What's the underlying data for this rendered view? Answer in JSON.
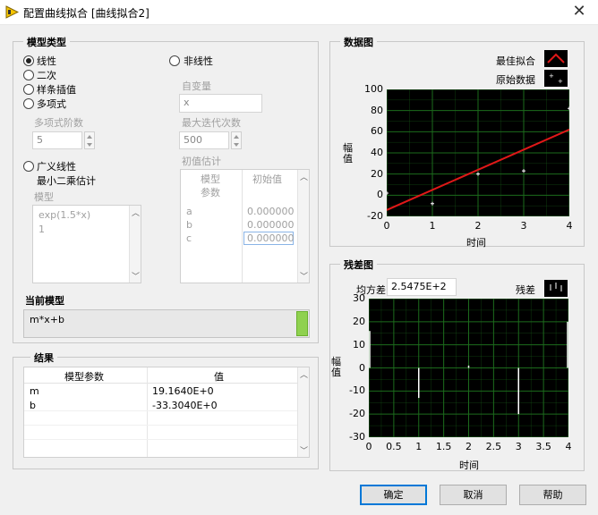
{
  "window": {
    "title": "配置曲线拟合 [曲线拟合2]",
    "close_glyph": "✕"
  },
  "model_type": {
    "legend": "模型类型",
    "options": [
      "线性",
      "二次",
      "样条插值",
      "多项式"
    ],
    "selected": "线性",
    "poly_order_label": "多项式阶数",
    "poly_order_value": "5",
    "nonlinear_label": "非线性",
    "indep_var_label": "自变量",
    "indep_var_value": "x",
    "max_iter_label": "最大迭代次数",
    "max_iter_value": "500",
    "initial_guess_label": "初值估计",
    "guess_table": {
      "col1_line1": "模型",
      "col1_line2": "参数",
      "col2": "初始值",
      "rows": [
        {
          "param": "a",
          "value": "0.000000"
        },
        {
          "param": "b",
          "value": "0.000000"
        },
        {
          "param": "c",
          "value": "0.000000"
        }
      ]
    },
    "general_linear_label": "广义线性",
    "least_squares_label": "最小二乘估计",
    "model_label": "模型",
    "model_lines": [
      "exp(1.5*x)",
      "1"
    ],
    "current_model_label": "当前模型",
    "current_model_value": "m*x+b"
  },
  "results": {
    "legend": "结果",
    "col_param": "模型参数",
    "col_value": "值",
    "rows": [
      {
        "param": "m",
        "value": "19.1640E+0"
      },
      {
        "param": "b",
        "value": "-33.3040E+0"
      }
    ]
  },
  "data_graph": {
    "legend": "数据图",
    "legend_best_fit": "最佳拟合",
    "legend_raw": "原始数据",
    "ylabel": "幅值",
    "xlabel": "时间",
    "x_ticks": [
      "0",
      "1",
      "2",
      "3",
      "4"
    ],
    "y_ticks": [
      "100",
      "80",
      "60",
      "40",
      "20",
      "0",
      "-20"
    ]
  },
  "residual_graph": {
    "legend": "残差图",
    "mse_label": "均方差",
    "mse_value": "2.5475E+2",
    "legend_residual": "残差",
    "ylabel": "幅值",
    "xlabel": "时间",
    "x_ticks": [
      "0",
      "0.5",
      "1",
      "1.5",
      "2",
      "2.5",
      "3",
      "3.5",
      "4"
    ],
    "y_ticks": [
      "30",
      "20",
      "10",
      "0",
      "-10",
      "-20",
      "-30"
    ]
  },
  "buttons": {
    "ok": "确定",
    "cancel": "取消",
    "help": "帮助"
  },
  "colors": {
    "fit_line": "#e01818",
    "plot_bg": "#000000",
    "grid": "#1c6b1c",
    "points": "#ffffff",
    "accent": "#0078d7",
    "indicator": "#8fd14f"
  },
  "chart_data": [
    {
      "type": "scatter",
      "title": "数据图",
      "xlabel": "时间",
      "ylabel": "幅值",
      "xlim": [
        0,
        4
      ],
      "ylim": [
        -20,
        100
      ],
      "series": [
        {
          "name": "原始数据",
          "points": [
            [
              0,
              2
            ],
            [
              1,
              -8
            ],
            [
              2,
              20
            ],
            [
              3,
              23
            ],
            [
              4,
              82
            ]
          ]
        },
        {
          "name": "最佳拟合",
          "kind": "line",
          "points": [
            [
              0,
              -14
            ],
            [
              4,
              62
            ]
          ]
        }
      ]
    },
    {
      "type": "bar",
      "title": "残差图",
      "xlabel": "时间",
      "ylabel": "幅值",
      "xlim": [
        0,
        4
      ],
      "ylim": [
        -30,
        30
      ],
      "series": [
        {
          "name": "残差",
          "points": [
            [
              0,
              16
            ],
            [
              1,
              -13
            ],
            [
              2,
              1
            ],
            [
              3,
              -20
            ],
            [
              4,
              20
            ]
          ]
        }
      ]
    }
  ]
}
